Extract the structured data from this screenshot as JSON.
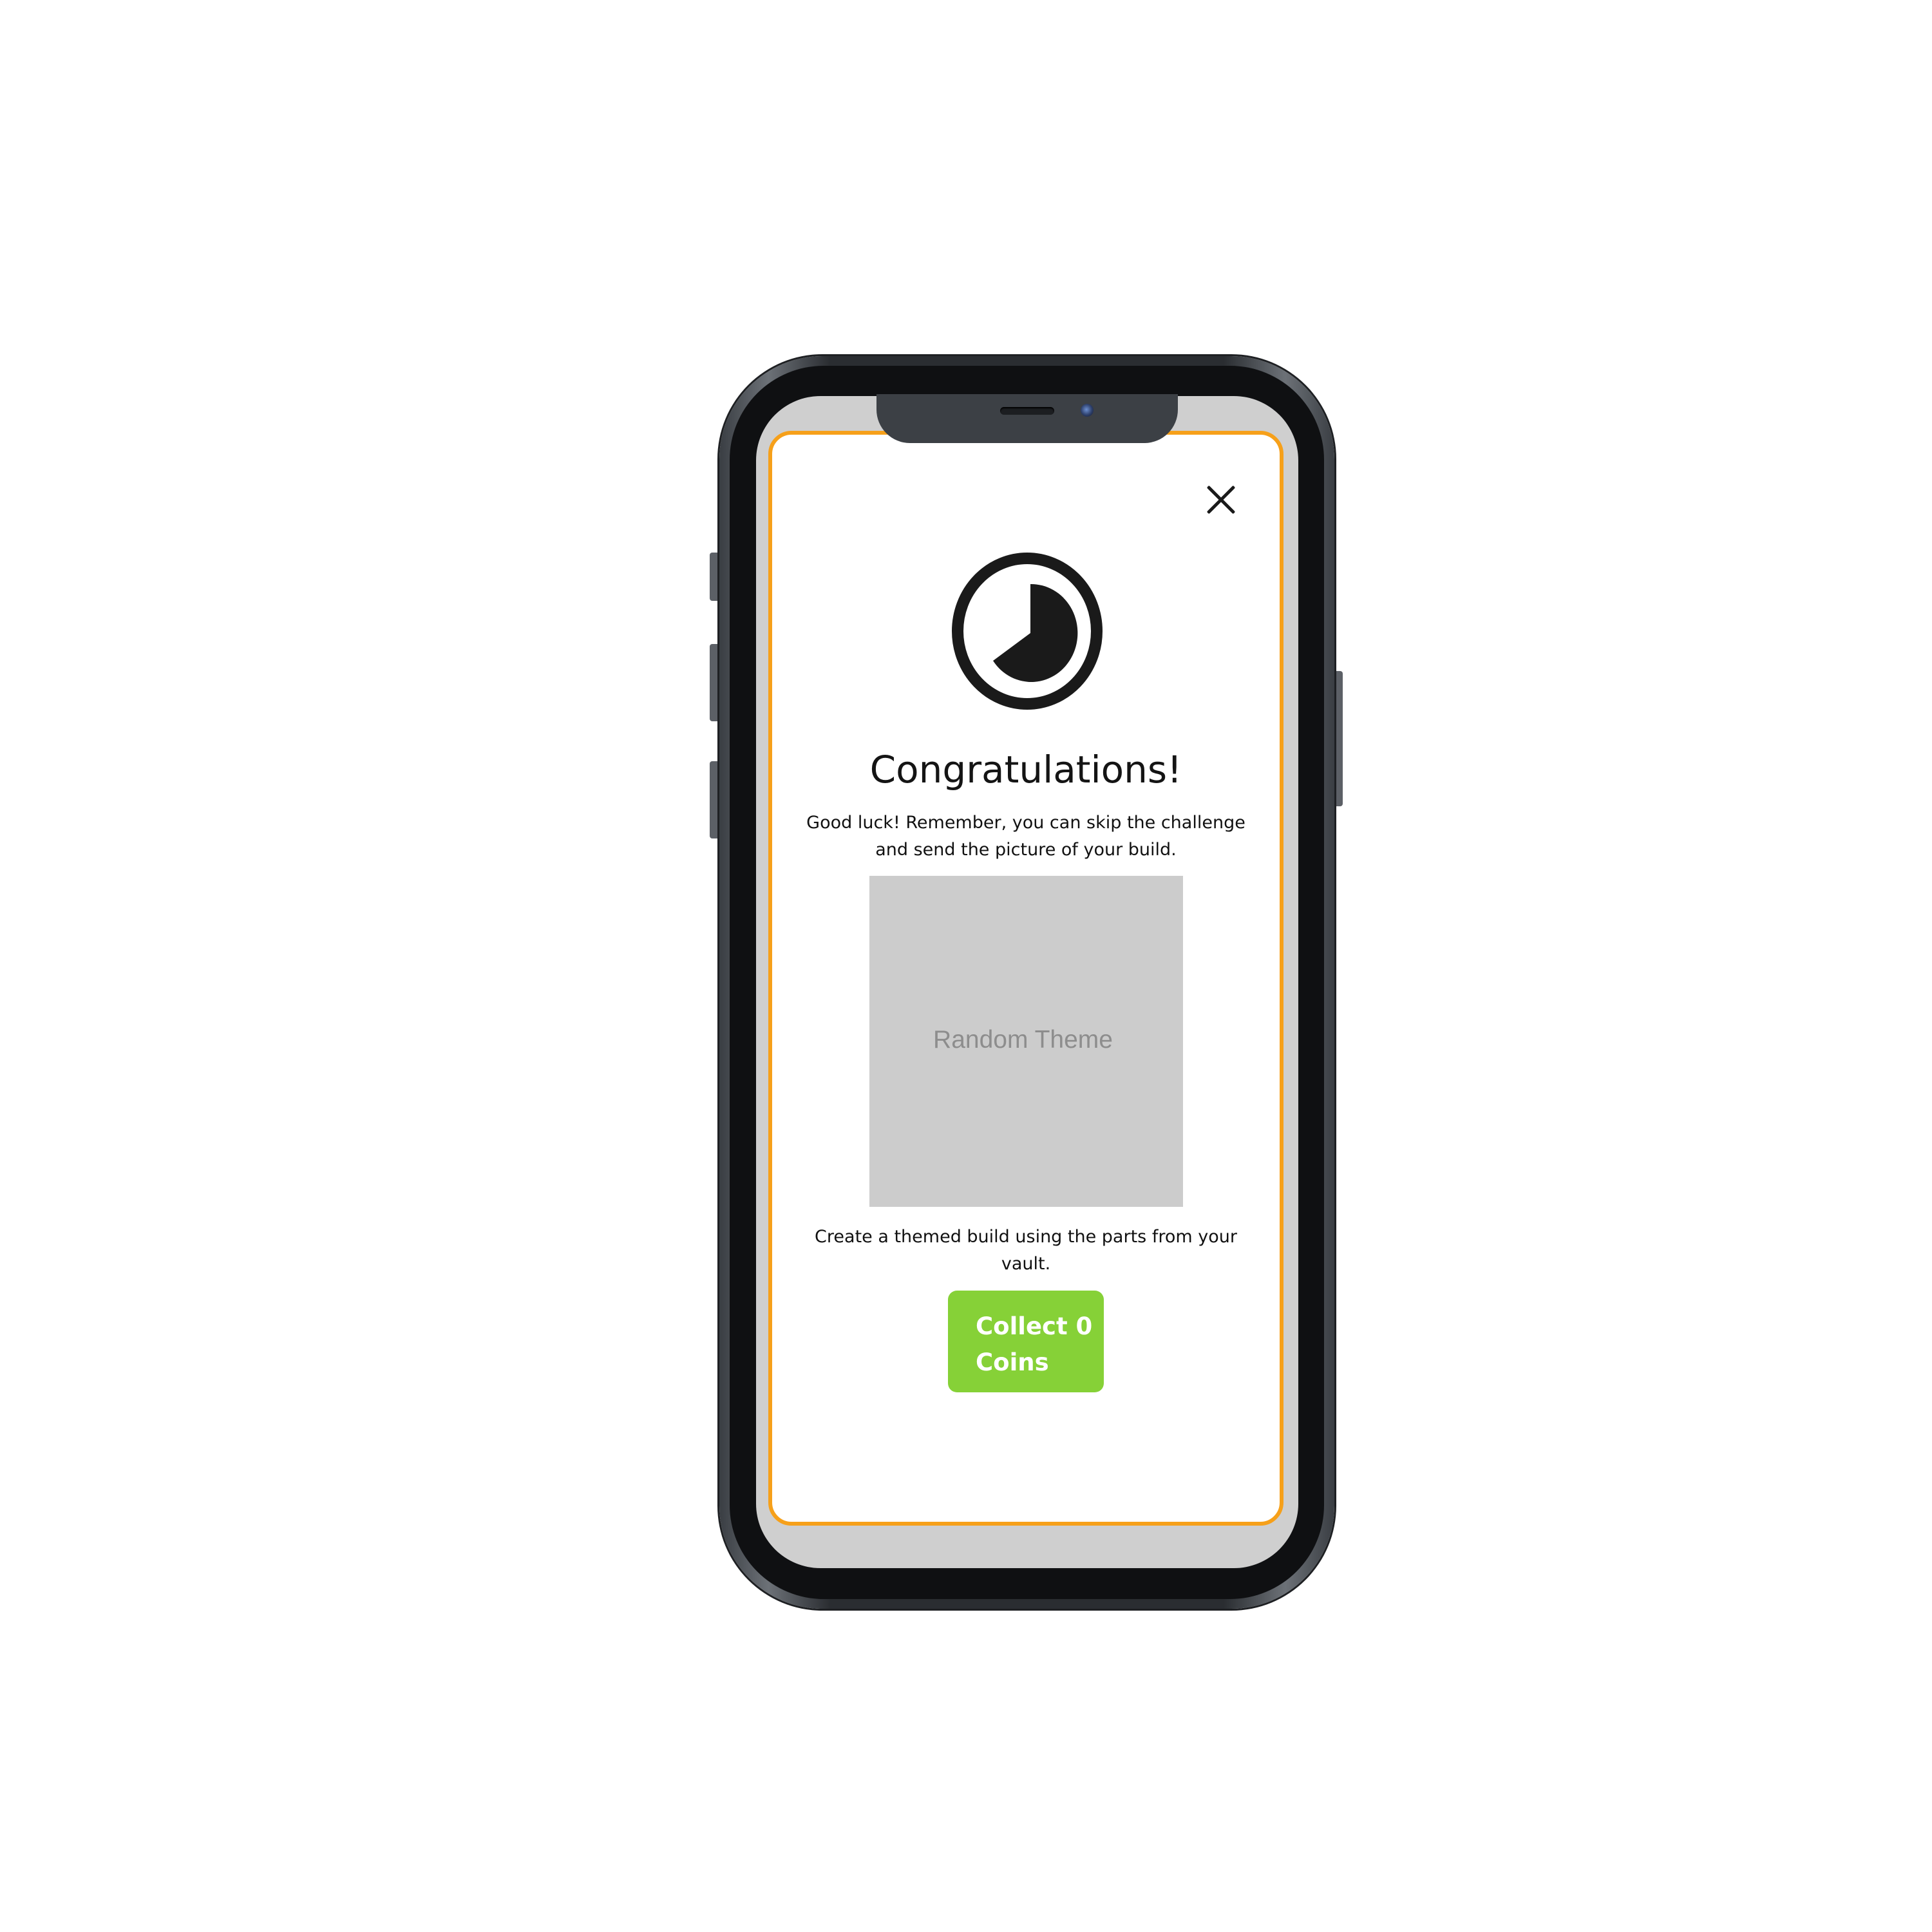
{
  "modal": {
    "title": "Congratulations!",
    "intro_text": "Good luck!  Remember, you can skip the challenge and send the picture of your build.",
    "theme_placeholder": "Random Theme",
    "instruction_text": "Create a themed build using the parts from your vault.",
    "collect_button_label": "Collect 0 Coins",
    "icons": {
      "close": "close-icon",
      "timer": "timer-icon"
    }
  },
  "colors": {
    "accent_border": "#f6a01a",
    "button_green": "#86d137",
    "placeholder_gray": "#cccccc"
  }
}
